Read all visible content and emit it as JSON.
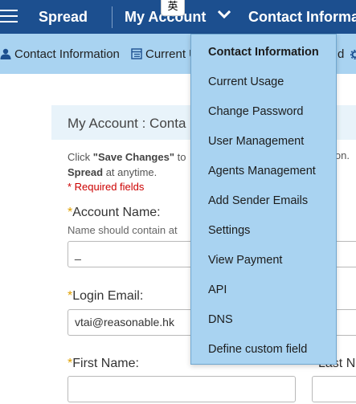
{
  "topbar": {
    "brand": "Spread",
    "my_account": "My Account",
    "contact_information": "Contact Informa",
    "ime_indicator": "英",
    "menu_icon": "hamburger-icon",
    "dropdown_icon": "chevron-down-icon"
  },
  "subnav": {
    "contact_information": "Contact Information",
    "current_usage": "Current U",
    "partial_right": "d",
    "partial_icon": "gear-icon"
  },
  "page": {
    "title": "My Account : Conta",
    "note_click": "Click ",
    "note_save": "\"Save Changes\"",
    "note_to": " to",
    "note_right": "ion.",
    "note_spread": "Spread",
    "note_anytime": " at anytime.",
    "required": "* Required fields",
    "account_name_label": "Account Name:",
    "account_name_hint": "Name should contain at",
    "account_name_value": "_",
    "login_email_label": "Login Email:",
    "login_email_value": "vtai@reasonable.hk",
    "first_name_label": "First Name:",
    "first_name_value": "",
    "last_name_label": "Last N",
    "last_name_value": "",
    "required_star": "*"
  },
  "dropdown": {
    "items": [
      {
        "label": "Contact Information",
        "active": true
      },
      {
        "label": "Current Usage",
        "active": false
      },
      {
        "label": "Change Password",
        "active": false
      },
      {
        "label": "User Management",
        "active": false
      },
      {
        "label": "Agents Management",
        "active": false
      },
      {
        "label": "Add Sender Emails",
        "active": false
      },
      {
        "label": "Settings",
        "active": false
      },
      {
        "label": "View Payment",
        "active": false
      },
      {
        "label": "API",
        "active": false
      },
      {
        "label": "DNS",
        "active": false
      },
      {
        "label": "Define custom field",
        "active": false
      }
    ]
  },
  "colors": {
    "topbar": "#1c4f8f",
    "subnav": "#a9d3f1",
    "dropdown": "#a9d3f1",
    "required": "#cc0000",
    "required_star": "#e0a000"
  }
}
